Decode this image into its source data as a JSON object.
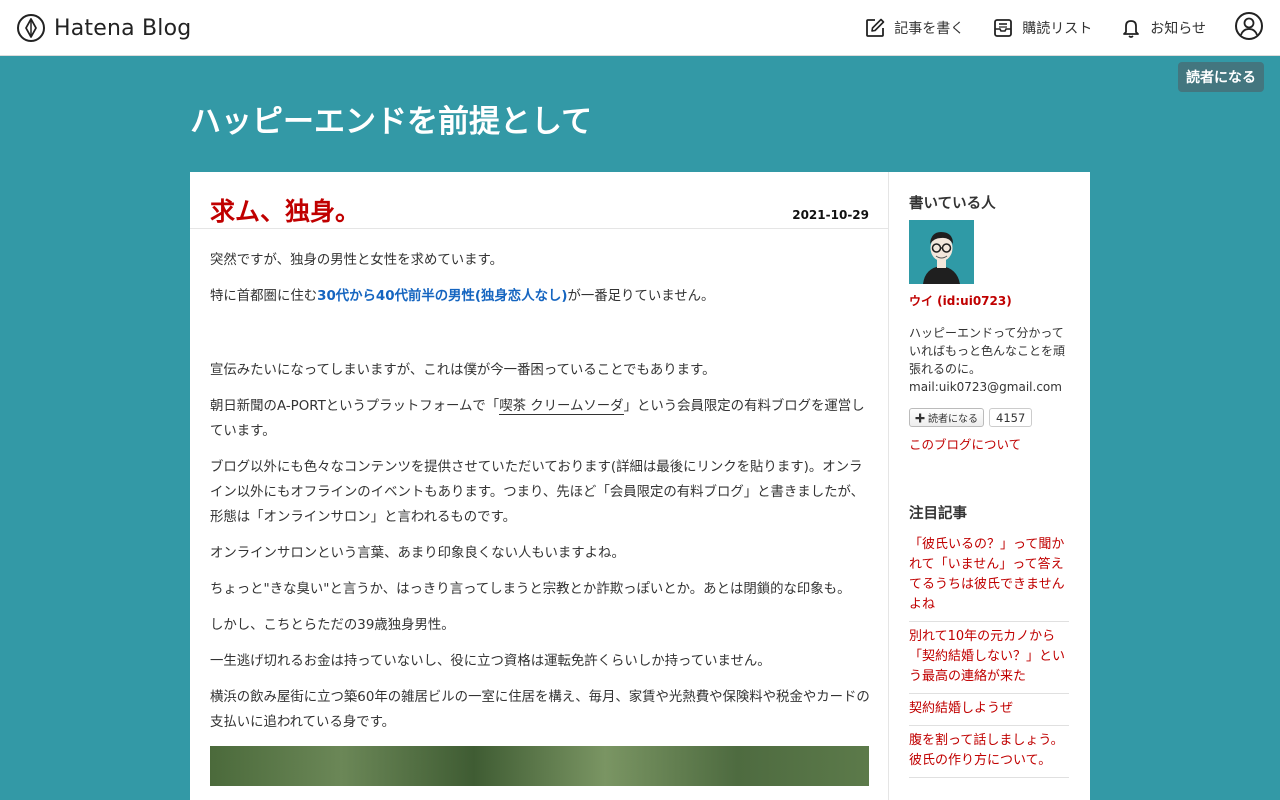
{
  "header": {
    "logo_text": "Hatena Blog",
    "nav": {
      "write": "記事を書く",
      "reading_list": "購読リスト",
      "notifications": "お知らせ"
    }
  },
  "subscribe_label": "読者になる",
  "blog_title": "ハッピーエンドを前提として",
  "entry": {
    "title": "求ム、独身。",
    "date": "2021-10-29",
    "p1": "突然ですが、独身の男性と女性を求めています。",
    "p2_before": "特に首都圏に住む",
    "p2_link": "30代から40代前半の男性(独身恋人なし)",
    "p2_after": "が一番足りていません。",
    "p3": "宣伝みたいになってしまいますが、これは僕が今一番困っていることでもあります。",
    "p4_before": "朝日新聞のA-PORTというプラットフォームで「",
    "p4_underlined": "喫茶 クリームソーダ",
    "p4_after": "」という会員限定の有料ブログを運営しています。",
    "p5": "ブログ以外にも色々なコンテンツを提供させていただいております(詳細は最後にリンクを貼ります)。オンライン以外にもオフラインのイベントもあります。つまり、先ほど「会員限定の有料ブログ」と書きましたが、形態は「オンラインサロン」と言われるものです。",
    "p6": "オンラインサロンという言葉、あまり印象良くない人もいますよね。",
    "p7": "ちょっと\"きな臭い\"と言うか、はっきり言ってしまうと宗教とか詐欺っぽいとか。あとは閉鎖的な印象も。",
    "p8": "しかし、こちとらただの39歳独身男性。",
    "p9": "一生逃げ切れるお金は持っていないし、役に立つ資格は運転免許くらいしか持っていません。",
    "p10": "横浜の飲み屋街に立つ築60年の雑居ビルの一室に住居を構え、毎月、家賃や光熱費や保険料や税金やカードの支払いに追われている身です。"
  },
  "sidebar": {
    "author_heading": "書いている人",
    "author_id": "ウイ (id:ui0723)",
    "description": "ハッピーエンドって分かっていればもっと色んなことを頑張れるのに。",
    "email": "mail:uik0723@gmail.com",
    "subscribe_small": "読者になる",
    "subscriber_count": "4157",
    "about_link": "このブログについて",
    "featured_heading": "注目記事",
    "featured": [
      "「彼氏いるの？」って聞かれて「いません」って答えてるうちは彼氏できませんよね",
      "別れて10年の元カノから「契約結婚しない？」という最高の連絡が来た",
      "契約結婚しようぜ",
      "腹を割って話しましょう。彼氏の作り方について。"
    ]
  },
  "colors": {
    "background": "#3399a6",
    "accent_red": "#c00000",
    "link_blue": "#1565c0"
  }
}
